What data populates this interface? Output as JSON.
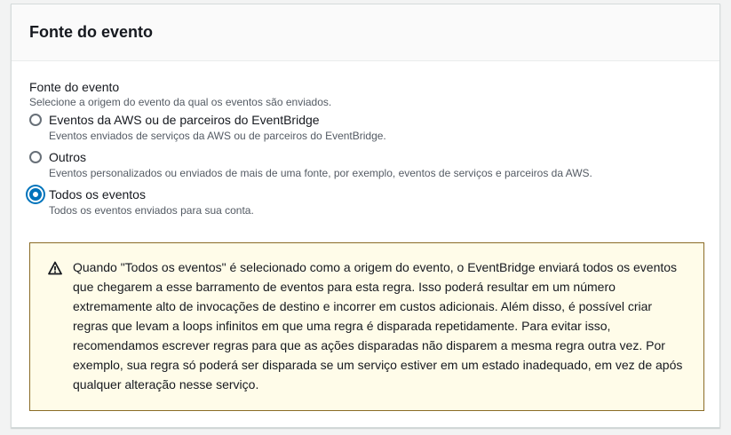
{
  "panel": {
    "title": "Fonte do evento"
  },
  "event_source": {
    "label": "Fonte do evento",
    "description": "Selecione a origem do evento da qual os eventos são enviados.",
    "options": [
      {
        "label": "Eventos da AWS ou de parceiros do EventBridge",
        "description": "Eventos enviados de serviços da AWS ou de parceiros do EventBridge.",
        "selected": false
      },
      {
        "label": "Outros",
        "description": "Eventos personalizados ou enviados de mais de uma fonte, por exemplo, eventos de serviços e parceiros da AWS.",
        "selected": false
      },
      {
        "label": "Todos os eventos",
        "description": "Todos os eventos enviados para sua conta.",
        "selected": true
      }
    ]
  },
  "alert": {
    "icon": "warning-icon",
    "text": "Quando \"Todos os eventos\" é selecionado como a origem do evento, o EventBridge enviará todos os eventos que chegarem a esse barramento de eventos para esta regra. Isso poderá resultar em um número extremamente alto de invocações de destino e incorrer em custos adicionais. Além disso, é possível criar regras que levam a loops infinitos em que uma regra é disparada repetidamente. Para evitar isso, recomendamos escrever regras para que as ações disparadas não disparem a mesma regra outra vez. Por exemplo, sua regra só poderá ser disparada se um serviço estiver em um estado inadequado, em vez de após qualquer alteração nesse serviço."
  },
  "colors": {
    "accent": "#0073bb",
    "warning_border": "#8b6c27",
    "warning_bg": "#fffce9"
  }
}
